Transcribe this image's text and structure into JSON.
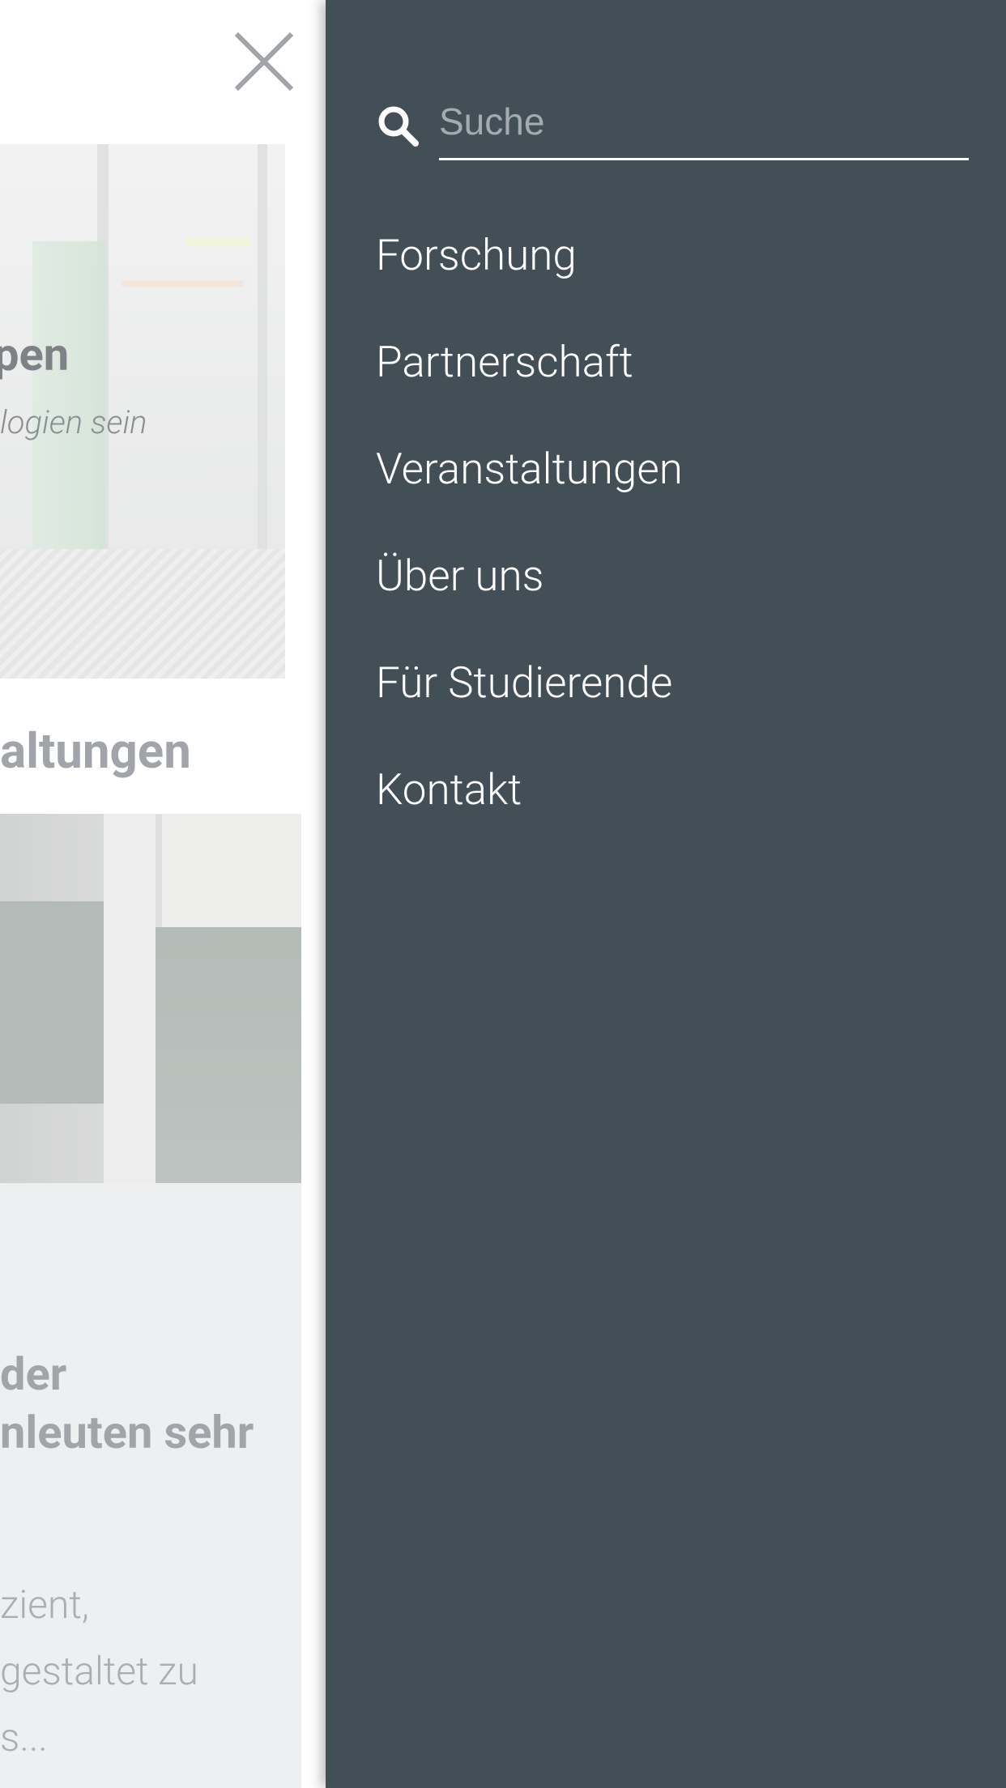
{
  "background_page": {
    "hero": {
      "title_fragment": "pen",
      "subtitle_fragment": "logien sein"
    },
    "section_heading_fragment": "altungen",
    "card": {
      "title_lines": [
        "der",
        "nleuten sehr"
      ],
      "text_lines": [
        "zient,",
        "gestaltet zu",
        "s..."
      ]
    },
    "close_icon": "close-icon"
  },
  "drawer": {
    "search": {
      "icon": "search-icon",
      "placeholder": "Suche",
      "value": ""
    },
    "nav_items": [
      {
        "label": "Forschung"
      },
      {
        "label": "Partnerschaft"
      },
      {
        "label": "Veranstaltungen"
      },
      {
        "label": "Über uns"
      },
      {
        "label": "Für Studierende"
      },
      {
        "label": "Kontakt"
      }
    ]
  },
  "colors": {
    "drawer_background": "#434f57",
    "drawer_text": "#ffffff",
    "search_placeholder": "#a3aab0",
    "card_background": "#e4e7ea",
    "close_icon": "#6f767c"
  }
}
